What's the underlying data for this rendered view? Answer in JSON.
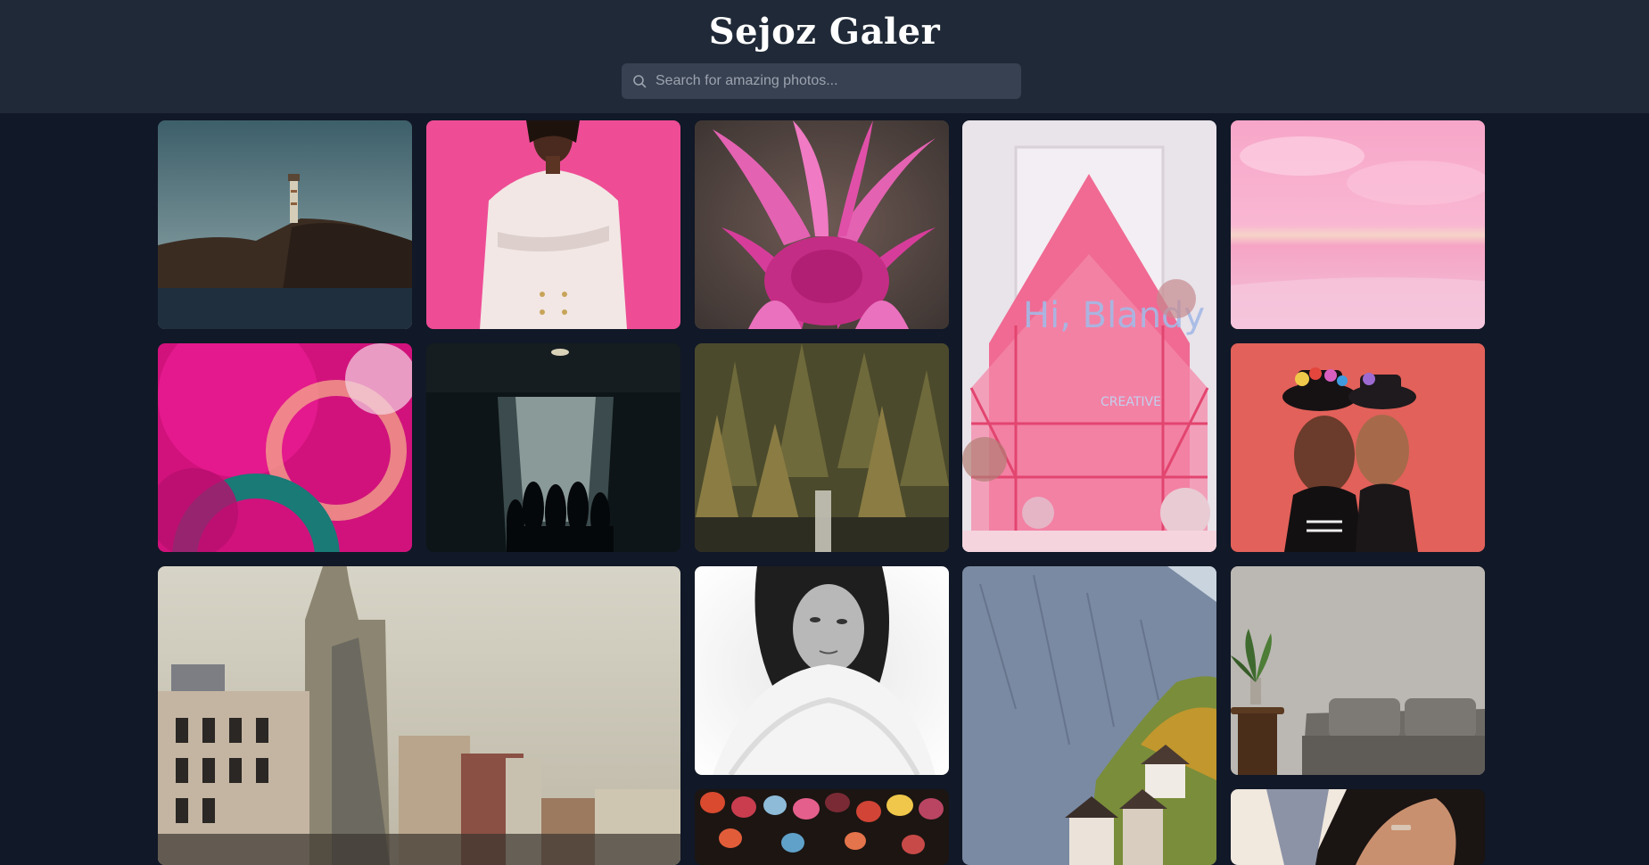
{
  "app": {
    "title": "Sejoz Galer"
  },
  "search": {
    "placeholder": "Search for amazing photos...",
    "value": ""
  },
  "gallery": {
    "photos": [
      {
        "subject": "lighthouse-on-rocky-coast"
      },
      {
        "subject": "woman-in-white-suit-pink-backdrop"
      },
      {
        "subject": "pink-dahlia-flower"
      },
      {
        "subject": "pink-storefront-installation"
      },
      {
        "subject": "pink-beach-sky"
      },
      {
        "subject": "pink-abstract-light-swirls"
      },
      {
        "subject": "dark-alley-silhouettes"
      },
      {
        "subject": "forest-waterfall"
      },
      {
        "subject": "painted-faces-flower-hats"
      },
      {
        "subject": "city-skyline-buildings"
      },
      {
        "subject": "black-white-portrait"
      },
      {
        "subject": "mountain-village-hallstatt"
      },
      {
        "subject": "plant-and-gray-sofa"
      },
      {
        "subject": "hanging-lanterns"
      },
      {
        "subject": "hands-closeup"
      }
    ]
  },
  "colors": {
    "page_background": "#111827",
    "header_background": "#1f2937",
    "search_background": "#374151",
    "title_color": "#ffffff",
    "placeholder_color": "#9ca3af"
  }
}
